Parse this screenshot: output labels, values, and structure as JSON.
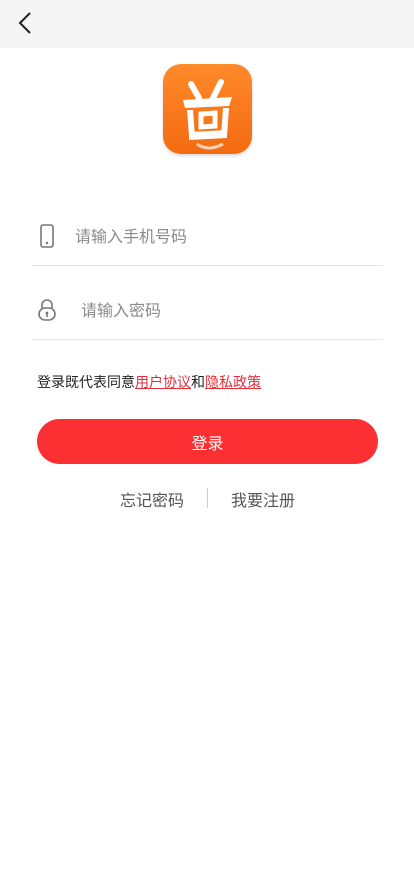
{
  "nav": {
    "back_icon": "chevron-left-icon"
  },
  "logo": {
    "name": "app-logo",
    "colors": {
      "top": "#ff8a2a",
      "bottom": "#f36a10"
    }
  },
  "form": {
    "phone": {
      "icon": "phone-icon",
      "placeholder": "请输入手机号码",
      "value": ""
    },
    "password": {
      "icon": "lock-icon",
      "placeholder": "请输入密码",
      "value": ""
    }
  },
  "agreement": {
    "prefix": "登录既代表同意",
    "user_agreement": "用户协议",
    "conjunction": "和",
    "privacy_policy": "隐私政策"
  },
  "login_button": {
    "label": "登录",
    "color": "#fc2f32"
  },
  "links": {
    "forgot": "忘记密码",
    "register": "我要注册"
  }
}
